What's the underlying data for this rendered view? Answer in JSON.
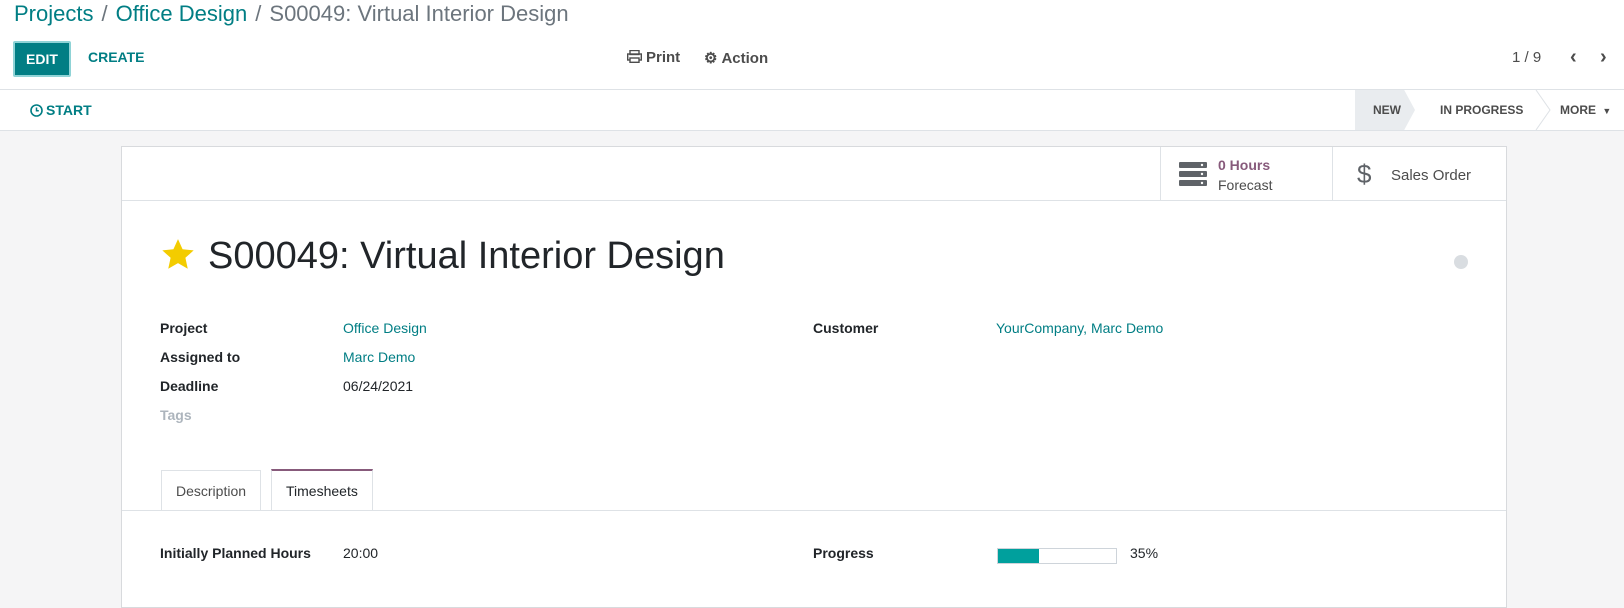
{
  "breadcrumb": {
    "root": "Projects",
    "parent": "Office Design",
    "current": "S00049: Virtual Interior Design",
    "separator": "/"
  },
  "toolbar": {
    "edit_label": "EDIT",
    "create_label": "CREATE",
    "print_label": "Print",
    "action_label": "Action"
  },
  "pager": {
    "value": "1 / 9"
  },
  "statusbar": {
    "start_label": "START",
    "stages": [
      "NEW",
      "IN PROGRESS"
    ],
    "more_label": "MORE"
  },
  "buttonbox": {
    "hours_value": "0  Hours",
    "hours_label": "Forecast",
    "sales_order_label": "Sales Order"
  },
  "task": {
    "title": "S00049: Virtual Interior Design",
    "fields": {
      "project_label": "Project",
      "project_value": "Office Design",
      "assigned_label": "Assigned to",
      "assigned_value": "Marc Demo",
      "deadline_label": "Deadline",
      "deadline_value": "06/24/2021",
      "tags_label": "Tags",
      "customer_label": "Customer",
      "customer_value": "YourCompany, Marc Demo"
    }
  },
  "tabs": [
    "Description",
    "Timesheets"
  ],
  "timesheets": {
    "planned_label": "Initially Planned Hours",
    "planned_value": "20:00",
    "progress_label": "Progress",
    "progress_value": "35%",
    "progress_fraction": 0.35
  },
  "colors": {
    "primary": "#017e84",
    "accent": "#875a7b",
    "progress": "#00a09d",
    "star": "#f3cc00"
  },
  "icons": [
    "print-icon",
    "gear-icon",
    "clock-icon",
    "caret-down-icon",
    "chevron-left-icon",
    "chevron-right-icon",
    "server-icon",
    "dollar-icon",
    "star-icon",
    "kanban-state-icon"
  ]
}
